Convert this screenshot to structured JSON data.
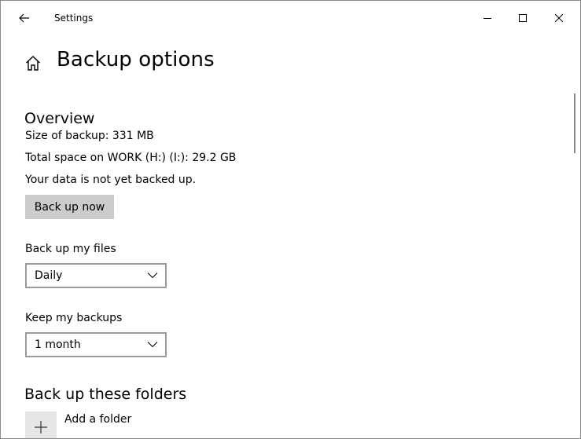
{
  "window": {
    "title": "Settings"
  },
  "page": {
    "title": "Backup options"
  },
  "overview": {
    "heading": "Overview",
    "size_of_backup": "Size of backup: 331 MB",
    "total_space": "Total space on WORK (H:) (I:): 29.2 GB",
    "status": "Your data is not yet backed up.",
    "back_up_now_label": "Back up now"
  },
  "backup_frequency": {
    "label": "Back up my files",
    "selected": "Daily"
  },
  "retention": {
    "label": "Keep my backups",
    "selected": "1 month"
  },
  "folders": {
    "heading": "Back up these folders",
    "add_folder_label": "Add a folder"
  },
  "icons": {
    "back": "arrow-left-icon",
    "minimize": "minimize-icon",
    "maximize": "maximize-icon",
    "close": "close-icon",
    "home": "home-icon",
    "chevron": "chevron-down-icon",
    "add": "plus-icon"
  }
}
